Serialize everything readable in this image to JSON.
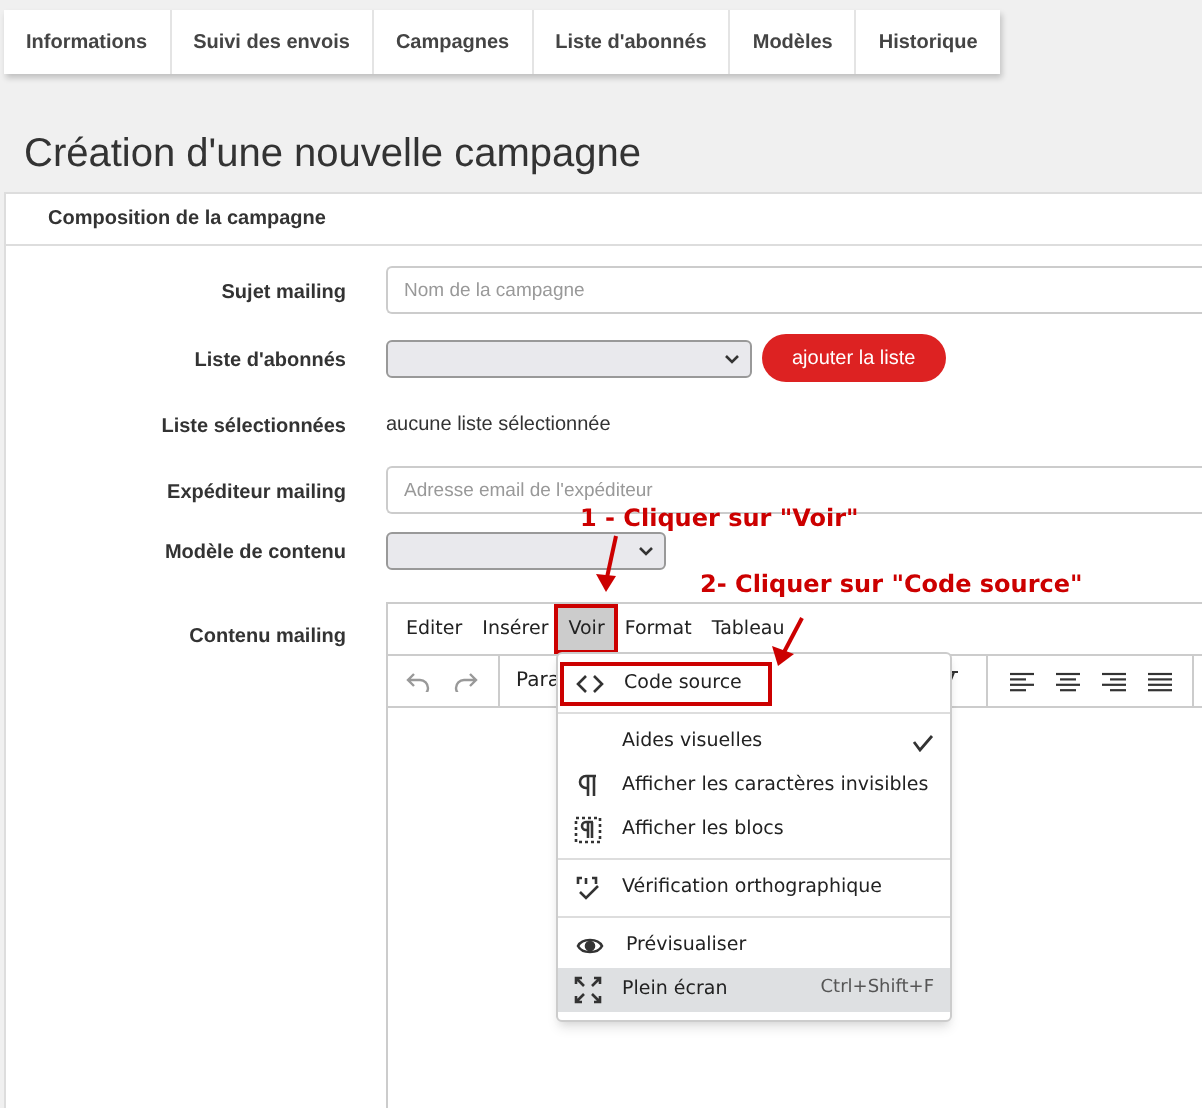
{
  "tabs": [
    {
      "label": "Informations"
    },
    {
      "label": "Suivi des envois"
    },
    {
      "label": "Campagnes"
    },
    {
      "label": "Liste d'abonnés"
    },
    {
      "label": "Modèles"
    },
    {
      "label": "Historique"
    }
  ],
  "title": "Création d'une nouvelle campagne",
  "section": "Composition de la campagne",
  "form": [
    {
      "kind": "input",
      "label": "Sujet mailing",
      "placeholder": "Nom de la campagne"
    },
    {
      "kind": "select-button",
      "label": "Liste d'abonnés",
      "button": "ajouter la liste"
    },
    {
      "kind": "text",
      "label": "Liste sélectionnées",
      "value": "aucune liste sélectionnée"
    },
    {
      "kind": "input",
      "label": "Expéditeur mailing",
      "placeholder": "Adresse email de l'expéditeur"
    },
    {
      "kind": "select",
      "label": "Modèle de contenu"
    },
    {
      "kind": "editor",
      "label": "Contenu mailing"
    }
  ],
  "editor": {
    "menubar": [
      {
        "label": "Editer",
        "selected": false
      },
      {
        "label": "Insérer",
        "selected": false
      },
      {
        "label": "Voir",
        "selected": true
      },
      {
        "label": "Format",
        "selected": false
      },
      {
        "label": "Tableau",
        "selected": false
      }
    ],
    "block_format": "Para",
    "menu": [
      [
        {
          "label": "Code source",
          "checked": false,
          "selected": false
        }
      ],
      [
        {
          "label": "Aides visuelles",
          "checked": true,
          "selected": false
        },
        {
          "label": "Afficher les caractères invisibles",
          "checked": false,
          "selected": false
        },
        {
          "label": "Afficher les blocs",
          "checked": false,
          "selected": false
        }
      ],
      [
        {
          "label": "Vérification orthographique",
          "checked": false,
          "selected": false
        }
      ],
      [
        {
          "label": "Prévisualiser",
          "checked": false,
          "selected": false
        },
        {
          "label": "Plein écran",
          "shortcut": "Ctrl+Shift+F",
          "checked": false,
          "selected": true
        }
      ]
    ]
  },
  "annotations": [
    {
      "text": "1 - Cliquer sur \"Voir\""
    },
    {
      "text": "2- Cliquer sur \"Code source\""
    }
  ]
}
